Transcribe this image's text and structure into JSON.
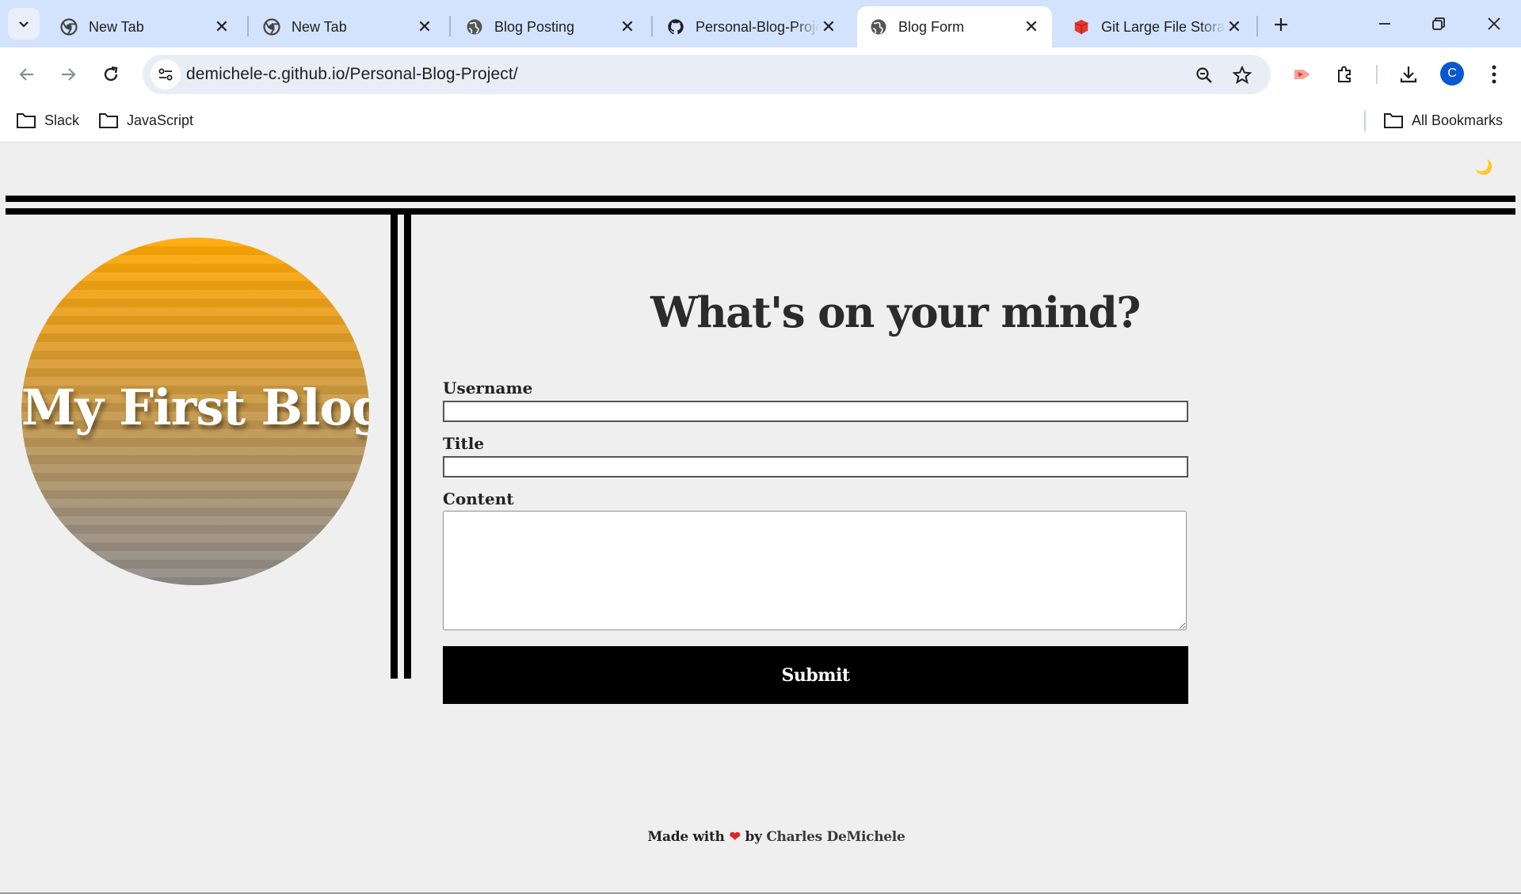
{
  "browser": {
    "tabs": [
      {
        "label": "New Tab",
        "icon": "chrome-icon",
        "active": false
      },
      {
        "label": "New Tab",
        "icon": "chrome-icon",
        "active": false
      },
      {
        "label": "Blog Posting",
        "icon": "globe-icon",
        "active": false
      },
      {
        "label": "Personal-Blog-Project",
        "icon": "github-icon",
        "active": false
      },
      {
        "label": "Blog Form",
        "icon": "globe-icon",
        "active": true
      },
      {
        "label": "Git Large File Storage",
        "icon": "git-lfs-icon",
        "active": false
      }
    ],
    "url": "demichele-c.github.io/Personal-Blog-Project/",
    "profile_initial": "C",
    "bookmarks": [
      {
        "label": "Slack"
      },
      {
        "label": "JavaScript"
      }
    ],
    "all_bookmarks_label": "All Bookmarks"
  },
  "page": {
    "theme_toggle_icon": "🌙",
    "logo_text": "My First Blog",
    "form": {
      "heading": "What's on your mind?",
      "username_label": "Username",
      "username_value": "",
      "title_label": "Title",
      "title_value": "",
      "content_label": "Content",
      "content_value": "",
      "submit_label": "Submit"
    },
    "footer": {
      "made_with": "Made with",
      "heart": "❤",
      "by": "by",
      "author": "Charles DeMichele"
    }
  },
  "colors": {
    "tabstrip_bg": "#d3e3fd",
    "page_bg": "#efefef",
    "logo_gradient_top": "#ffa800",
    "logo_gradient_bottom": "#8e8b88",
    "submit_bg": "#000000",
    "heart": "#e0242c",
    "profile_avatar": "#0b57d0"
  }
}
